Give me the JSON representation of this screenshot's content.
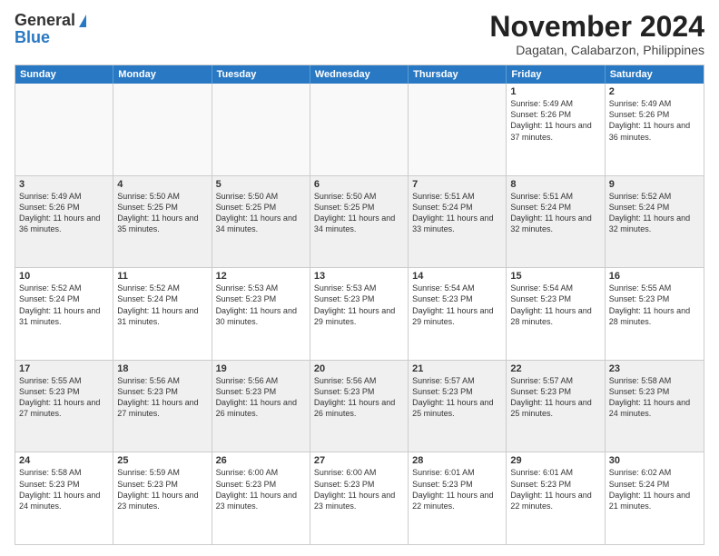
{
  "header": {
    "logo_general": "General",
    "logo_blue": "Blue",
    "month_title": "November 2024",
    "location": "Dagatan, Calabarzon, Philippines"
  },
  "calendar": {
    "days_of_week": [
      "Sunday",
      "Monday",
      "Tuesday",
      "Wednesday",
      "Thursday",
      "Friday",
      "Saturday"
    ],
    "weeks": [
      [
        {
          "day": "",
          "info": "",
          "empty": true
        },
        {
          "day": "",
          "info": "",
          "empty": true
        },
        {
          "day": "",
          "info": "",
          "empty": true
        },
        {
          "day": "",
          "info": "",
          "empty": true
        },
        {
          "day": "",
          "info": "",
          "empty": true
        },
        {
          "day": "1",
          "info": "Sunrise: 5:49 AM\nSunset: 5:26 PM\nDaylight: 11 hours\nand 37 minutes.",
          "empty": false
        },
        {
          "day": "2",
          "info": "Sunrise: 5:49 AM\nSunset: 5:26 PM\nDaylight: 11 hours\nand 36 minutes.",
          "empty": false
        }
      ],
      [
        {
          "day": "3",
          "info": "Sunrise: 5:49 AM\nSunset: 5:26 PM\nDaylight: 11 hours\nand 36 minutes.",
          "empty": false
        },
        {
          "day": "4",
          "info": "Sunrise: 5:50 AM\nSunset: 5:25 PM\nDaylight: 11 hours\nand 35 minutes.",
          "empty": false
        },
        {
          "day": "5",
          "info": "Sunrise: 5:50 AM\nSunset: 5:25 PM\nDaylight: 11 hours\nand 34 minutes.",
          "empty": false
        },
        {
          "day": "6",
          "info": "Sunrise: 5:50 AM\nSunset: 5:25 PM\nDaylight: 11 hours\nand 34 minutes.",
          "empty": false
        },
        {
          "day": "7",
          "info": "Sunrise: 5:51 AM\nSunset: 5:24 PM\nDaylight: 11 hours\nand 33 minutes.",
          "empty": false
        },
        {
          "day": "8",
          "info": "Sunrise: 5:51 AM\nSunset: 5:24 PM\nDaylight: 11 hours\nand 32 minutes.",
          "empty": false
        },
        {
          "day": "9",
          "info": "Sunrise: 5:52 AM\nSunset: 5:24 PM\nDaylight: 11 hours\nand 32 minutes.",
          "empty": false
        }
      ],
      [
        {
          "day": "10",
          "info": "Sunrise: 5:52 AM\nSunset: 5:24 PM\nDaylight: 11 hours\nand 31 minutes.",
          "empty": false
        },
        {
          "day": "11",
          "info": "Sunrise: 5:52 AM\nSunset: 5:24 PM\nDaylight: 11 hours\nand 31 minutes.",
          "empty": false
        },
        {
          "day": "12",
          "info": "Sunrise: 5:53 AM\nSunset: 5:23 PM\nDaylight: 11 hours\nand 30 minutes.",
          "empty": false
        },
        {
          "day": "13",
          "info": "Sunrise: 5:53 AM\nSunset: 5:23 PM\nDaylight: 11 hours\nand 29 minutes.",
          "empty": false
        },
        {
          "day": "14",
          "info": "Sunrise: 5:54 AM\nSunset: 5:23 PM\nDaylight: 11 hours\nand 29 minutes.",
          "empty": false
        },
        {
          "day": "15",
          "info": "Sunrise: 5:54 AM\nSunset: 5:23 PM\nDaylight: 11 hours\nand 28 minutes.",
          "empty": false
        },
        {
          "day": "16",
          "info": "Sunrise: 5:55 AM\nSunset: 5:23 PM\nDaylight: 11 hours\nand 28 minutes.",
          "empty": false
        }
      ],
      [
        {
          "day": "17",
          "info": "Sunrise: 5:55 AM\nSunset: 5:23 PM\nDaylight: 11 hours\nand 27 minutes.",
          "empty": false
        },
        {
          "day": "18",
          "info": "Sunrise: 5:56 AM\nSunset: 5:23 PM\nDaylight: 11 hours\nand 27 minutes.",
          "empty": false
        },
        {
          "day": "19",
          "info": "Sunrise: 5:56 AM\nSunset: 5:23 PM\nDaylight: 11 hours\nand 26 minutes.",
          "empty": false
        },
        {
          "day": "20",
          "info": "Sunrise: 5:56 AM\nSunset: 5:23 PM\nDaylight: 11 hours\nand 26 minutes.",
          "empty": false
        },
        {
          "day": "21",
          "info": "Sunrise: 5:57 AM\nSunset: 5:23 PM\nDaylight: 11 hours\nand 25 minutes.",
          "empty": false
        },
        {
          "day": "22",
          "info": "Sunrise: 5:57 AM\nSunset: 5:23 PM\nDaylight: 11 hours\nand 25 minutes.",
          "empty": false
        },
        {
          "day": "23",
          "info": "Sunrise: 5:58 AM\nSunset: 5:23 PM\nDaylight: 11 hours\nand 24 minutes.",
          "empty": false
        }
      ],
      [
        {
          "day": "24",
          "info": "Sunrise: 5:58 AM\nSunset: 5:23 PM\nDaylight: 11 hours\nand 24 minutes.",
          "empty": false
        },
        {
          "day": "25",
          "info": "Sunrise: 5:59 AM\nSunset: 5:23 PM\nDaylight: 11 hours\nand 23 minutes.",
          "empty": false
        },
        {
          "day": "26",
          "info": "Sunrise: 6:00 AM\nSunset: 5:23 PM\nDaylight: 11 hours\nand 23 minutes.",
          "empty": false
        },
        {
          "day": "27",
          "info": "Sunrise: 6:00 AM\nSunset: 5:23 PM\nDaylight: 11 hours\nand 23 minutes.",
          "empty": false
        },
        {
          "day": "28",
          "info": "Sunrise: 6:01 AM\nSunset: 5:23 PM\nDaylight: 11 hours\nand 22 minutes.",
          "empty": false
        },
        {
          "day": "29",
          "info": "Sunrise: 6:01 AM\nSunset: 5:23 PM\nDaylight: 11 hours\nand 22 minutes.",
          "empty": false
        },
        {
          "day": "30",
          "info": "Sunrise: 6:02 AM\nSunset: 5:24 PM\nDaylight: 11 hours\nand 21 minutes.",
          "empty": false
        }
      ]
    ]
  }
}
